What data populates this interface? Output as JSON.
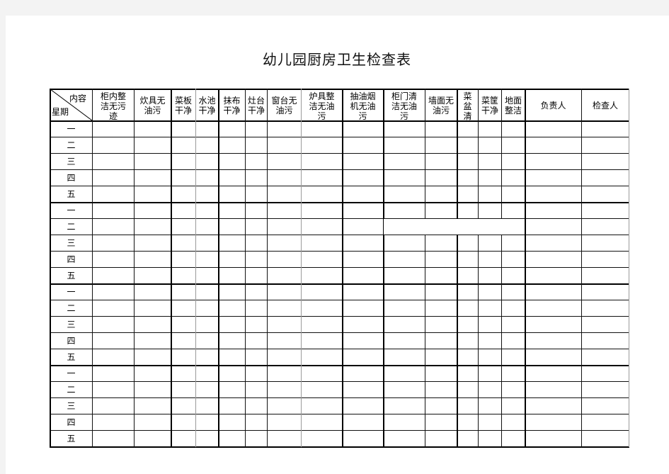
{
  "document": {
    "title": "幼儿园厨房卫生检查表",
    "corner_header": {
      "top_right": "内容",
      "bottom_left": "星期"
    },
    "columns": [
      {
        "key": "cabinet_inside",
        "label": "柜内整\n洁无污\n迹"
      },
      {
        "key": "cookware",
        "label": "炊具无\n油污"
      },
      {
        "key": "cutting_board",
        "label": "菜板\n干净"
      },
      {
        "key": "sink",
        "label": "水池\n干净"
      },
      {
        "key": "rag",
        "label": "抹布\n干净"
      },
      {
        "key": "stove",
        "label": "灶台\n干净"
      },
      {
        "key": "windowsill",
        "label": "窗台无\n油污"
      },
      {
        "key": "utensils",
        "label": "炉具整\n洁无油\n污"
      },
      {
        "key": "range_hood",
        "label": "抽油烟\n机无油\n污"
      },
      {
        "key": "cabinet_door",
        "label": "柜门清\n洁无油\n污"
      },
      {
        "key": "wall",
        "label": "墙面无\n油污"
      },
      {
        "key": "veg_basin",
        "label": "菜\n盆\n清"
      },
      {
        "key": "veg_basket",
        "label": "菜筐\n干净"
      },
      {
        "key": "floor",
        "label": "地面\n整洁"
      },
      {
        "key": "responsible",
        "label": "负责人"
      },
      {
        "key": "inspector",
        "label": "检查人"
      }
    ],
    "rows": [
      {
        "day": "一"
      },
      {
        "day": "二"
      },
      {
        "day": "三"
      },
      {
        "day": "四"
      },
      {
        "day": "五"
      },
      {
        "day": "一"
      },
      {
        "day": "二"
      },
      {
        "day": "三"
      },
      {
        "day": "四"
      },
      {
        "day": "五"
      },
      {
        "day": "一"
      },
      {
        "day": "二"
      },
      {
        "day": "三"
      },
      {
        "day": "四"
      },
      {
        "day": "五"
      },
      {
        "day": "一"
      },
      {
        "day": "二"
      },
      {
        "day": "三"
      },
      {
        "day": "四"
      },
      {
        "day": "五"
      }
    ]
  }
}
